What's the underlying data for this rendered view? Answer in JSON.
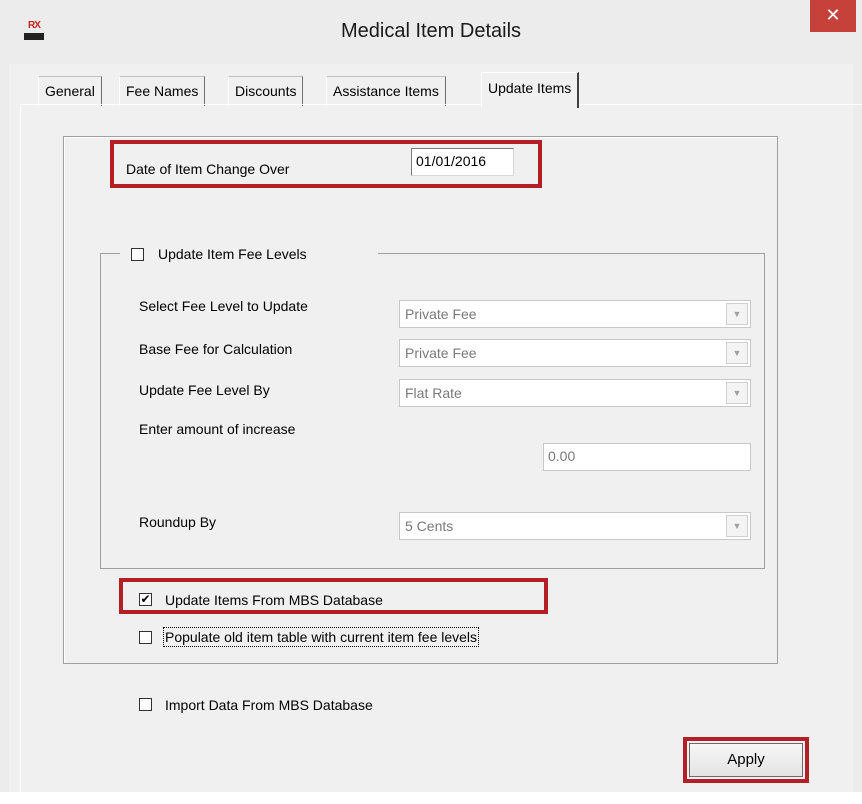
{
  "window": {
    "title": "Medical Item Details",
    "app_icon": {
      "top": "RX",
      "name": "rx-logo-icon"
    },
    "close_glyph": "✕"
  },
  "tabs": [
    {
      "label": "General",
      "active": false
    },
    {
      "label": "Fee Names",
      "active": false
    },
    {
      "label": "Discounts",
      "active": false
    },
    {
      "label": "Assistance Items",
      "active": false
    },
    {
      "label": "Update Items",
      "active": true
    }
  ],
  "update_items": {
    "change_over": {
      "label": "Date of Item Change Over",
      "value": "01/01/2016"
    },
    "fee_levels_group": {
      "checkbox_label": "Update Item Fee Levels",
      "checked": false,
      "select_fee_level": {
        "label": "Select Fee Level to Update",
        "value": "Private Fee"
      },
      "base_fee": {
        "label": "Base Fee for Calculation",
        "value": "Private Fee"
      },
      "update_by": {
        "label": "Update Fee Level By",
        "value": "Flat Rate"
      },
      "increase": {
        "label": "Enter amount of increase",
        "value": "0.00"
      },
      "roundup": {
        "label": "Roundup By",
        "value": "5 Cents"
      }
    },
    "update_from_mbs": {
      "label": "Update Items From MBS Database",
      "checked": true
    },
    "populate_old": {
      "label": "Populate old item table with current item fee levels",
      "checked": false
    },
    "import_mbs": {
      "label": "Import Data From MBS Database",
      "checked": false
    },
    "apply_label": "Apply"
  },
  "colors": {
    "highlight": "#b31f24",
    "close_button": "#c7413b",
    "dialog_bg": "#f0f0f0"
  }
}
